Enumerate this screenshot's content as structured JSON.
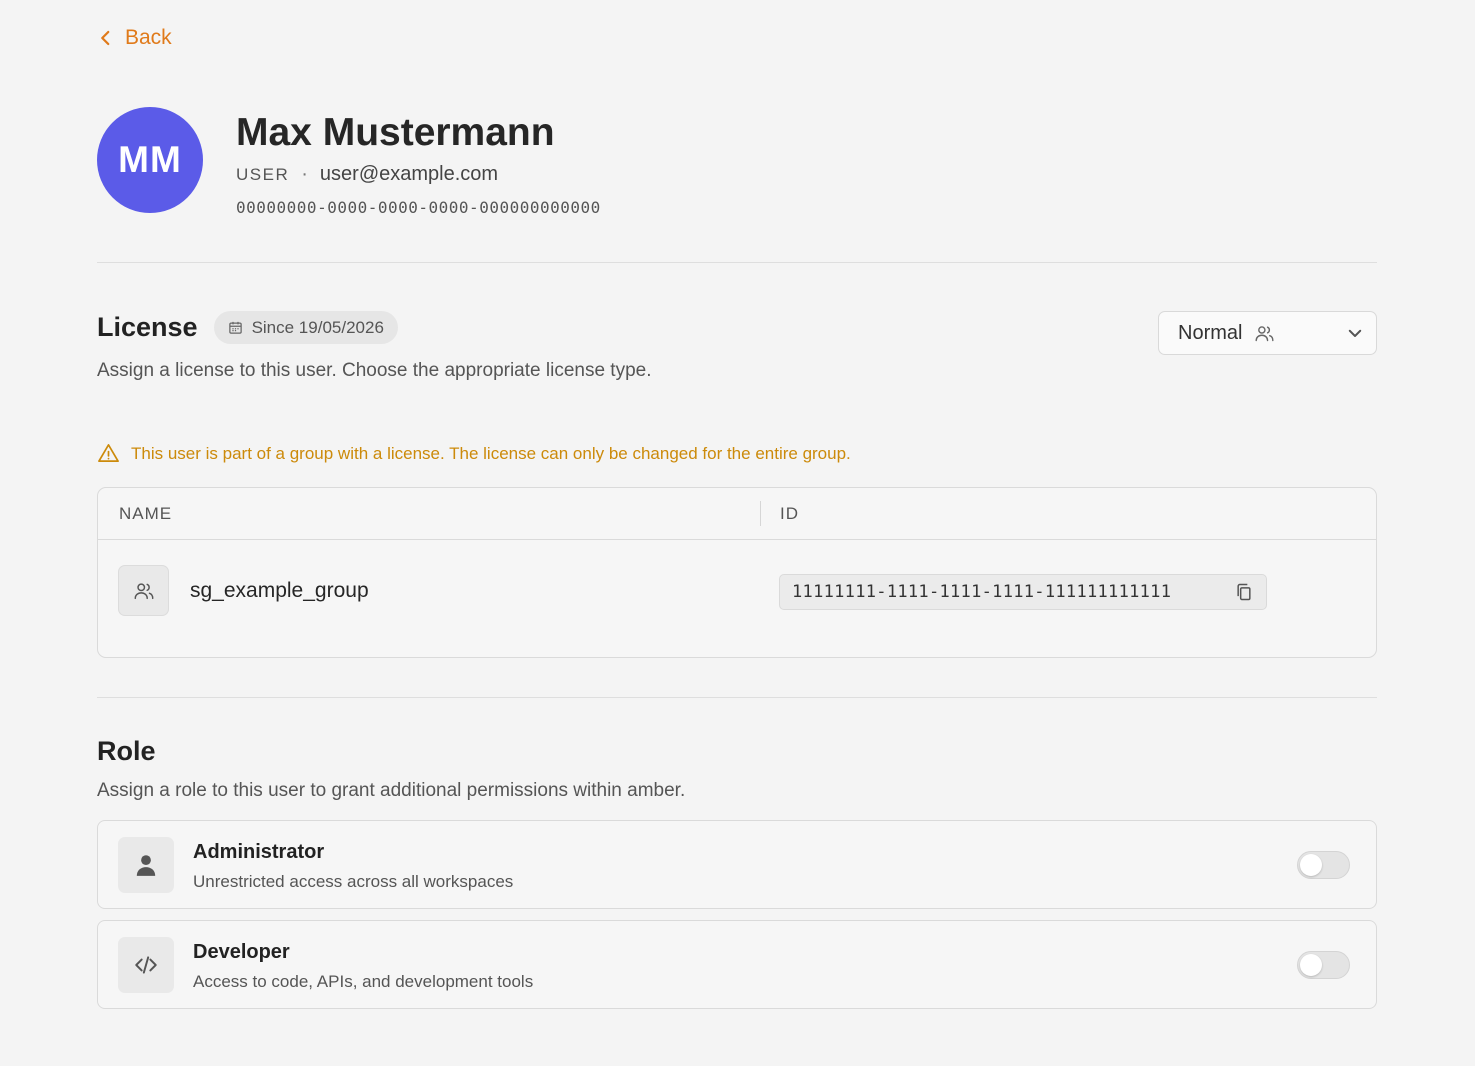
{
  "back": {
    "label": "Back",
    "icon": "chevron-left-icon"
  },
  "profile": {
    "initials": "MM",
    "name": "Max Mustermann",
    "role": "USER",
    "separator": "·",
    "email": "user@example.com",
    "uuid": "00000000-0000-0000-0000-000000000000",
    "avatar_color": "#5b5be8"
  },
  "license": {
    "title": "License",
    "since": "Since 19/05/2026",
    "description": "Assign a license to this user. Choose the appropriate license type.",
    "selected_type": "Normal",
    "warning": "This user is part of a group with a license. The license can only be changed for the entire group.",
    "table": {
      "columns": [
        "NAME",
        "ID"
      ],
      "rows": [
        {
          "name": "sg_example_group",
          "id": "11111111-1111-1111-1111-111111111111"
        }
      ]
    }
  },
  "role": {
    "title": "Role",
    "description": "Assign a role to this user to grant additional permissions within amber.",
    "items": [
      {
        "title": "Administrator",
        "description": "Unrestricted access across all workspaces",
        "icon": "person-icon",
        "enabled": false
      },
      {
        "title": "Developer",
        "description": "Access to code, APIs, and development tools",
        "icon": "code-icon",
        "enabled": false
      }
    ]
  },
  "colors": {
    "accent": "#e07a1a",
    "warning": "#cc8a0a",
    "background": "#f4f4f4"
  }
}
